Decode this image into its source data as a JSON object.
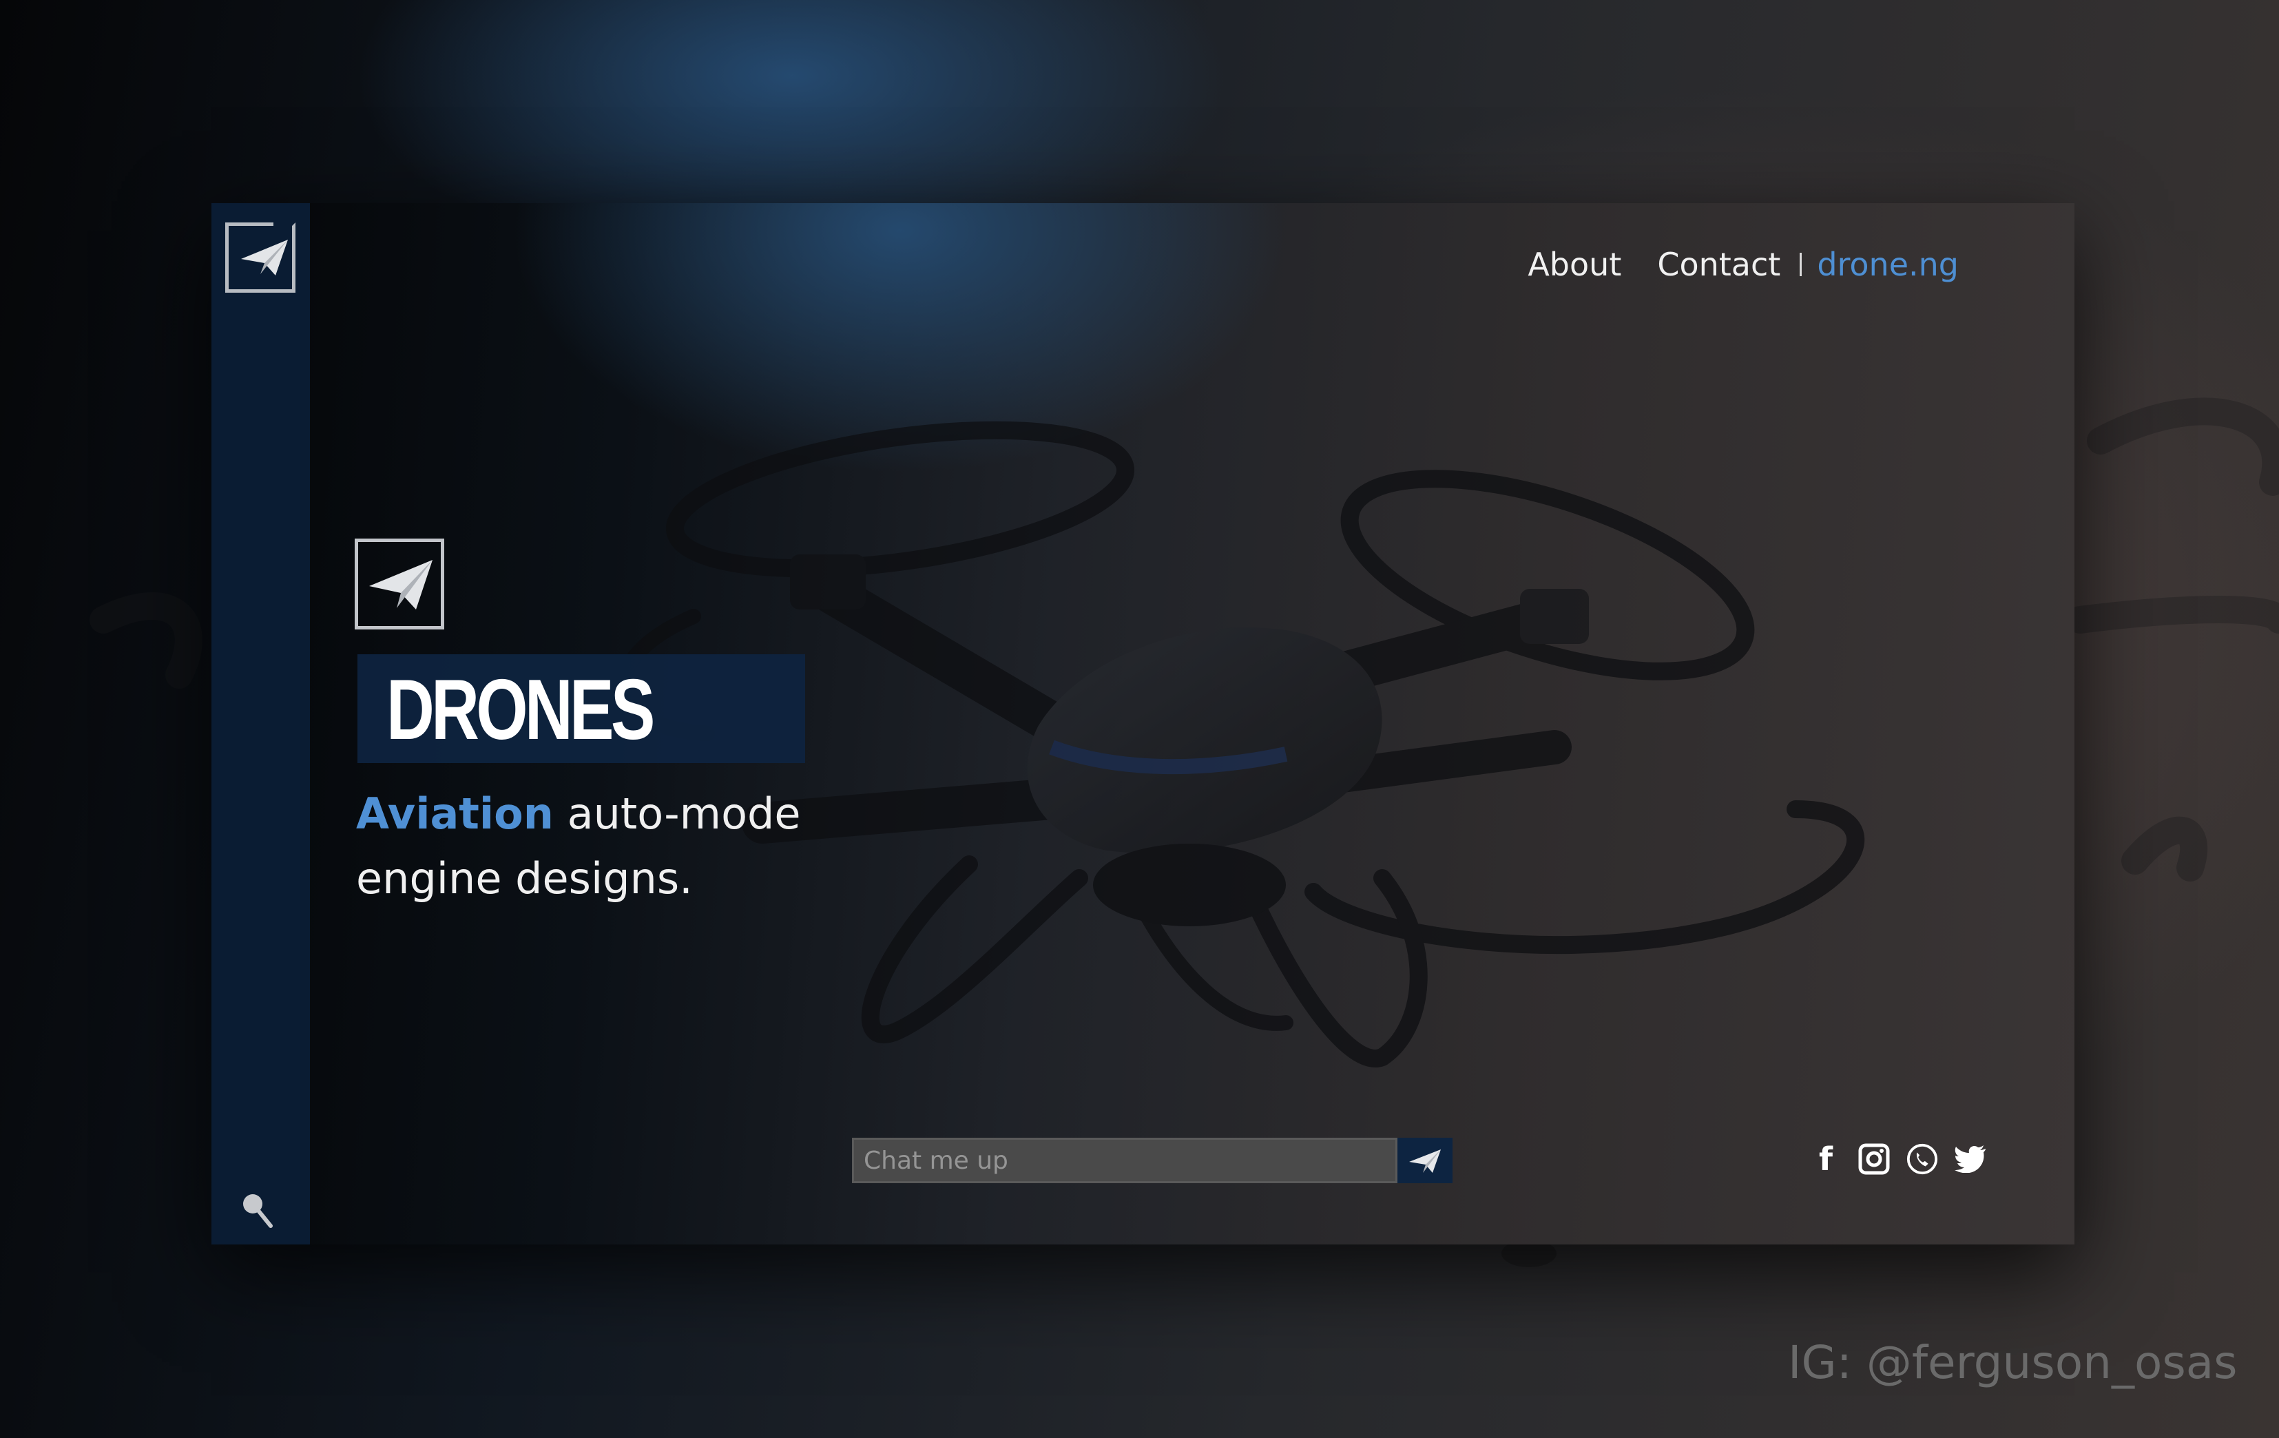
{
  "nav": {
    "about_label": "About",
    "contact_label": "Contact",
    "site_label": "drone.ng"
  },
  "hero": {
    "title": "DRONES",
    "tagline_accent": "Aviation",
    "tagline_rest": " auto-mode engine designs."
  },
  "chat": {
    "placeholder": "Chat me up"
  },
  "social": {
    "icons": [
      "facebook-icon",
      "instagram-icon",
      "whatsapp-icon",
      "twitter-icon"
    ]
  },
  "watermark": "IG: @ferguson_osas",
  "colors": {
    "accent": "#4f90d5",
    "sidebar": "#0a1c33",
    "title_box": "#0e2440",
    "send_button": "#0d2441"
  }
}
